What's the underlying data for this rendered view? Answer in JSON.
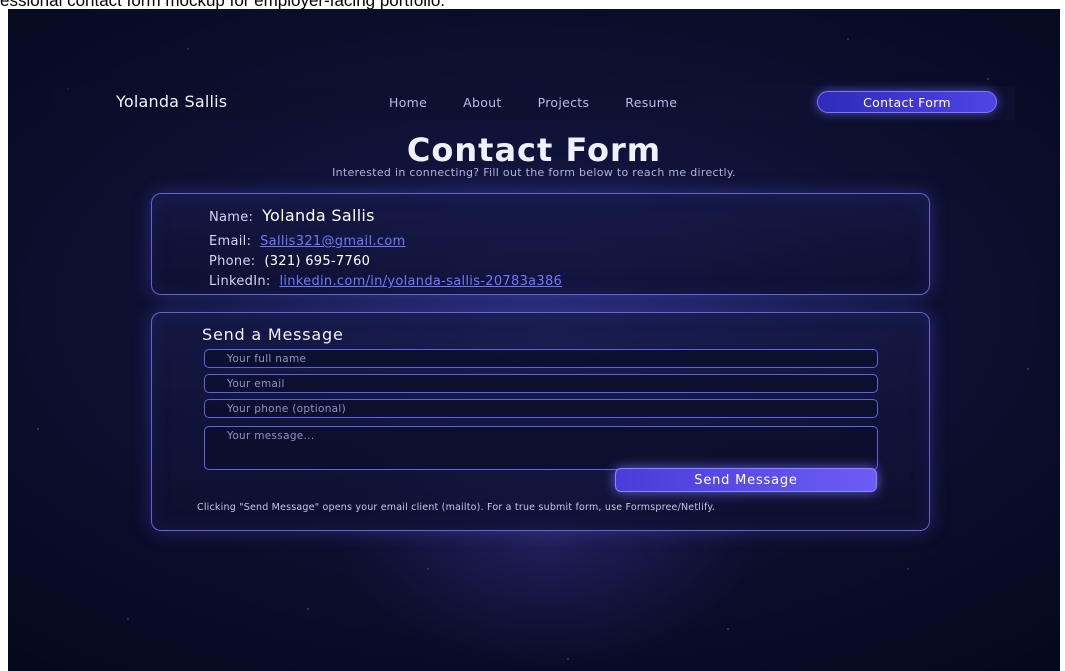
{
  "caption": "essional contact form mockup for employer-facing portfolio.",
  "nav": {
    "brand": "Yolanda Sallis",
    "links": [
      "Home",
      "About",
      "Projects",
      "Resume"
    ],
    "cta": "Contact Form"
  },
  "header": {
    "title": "Contact Form",
    "subtitle": "Interested in connecting? Fill out the form below to reach me directly."
  },
  "contact_info": {
    "name_label": "Name:",
    "name_value": "Yolanda Sallis",
    "email_label": "Email:",
    "email_value": "Sallis321@gmail.com",
    "phone_label": "Phone:",
    "phone_value": "(321) 695-7760",
    "linkedin_label": "LinkedIn:",
    "linkedin_value": "linkedin.com/in/yolanda-sallis-20783a386"
  },
  "message_form": {
    "title": "Send a Message",
    "name_placeholder": "Your full name",
    "email_placeholder": "Your email",
    "phone_placeholder": "Your phone (optional)",
    "message_placeholder": "Your message...",
    "send_label": "Send Message",
    "note": "Clicking \"Send Message\" opens your email client (mailto). For a true submit form, use Formspree/Netlify."
  },
  "colors": {
    "accent": "#5046e5",
    "link": "#6f78ff",
    "background": "#0b0e2c"
  }
}
